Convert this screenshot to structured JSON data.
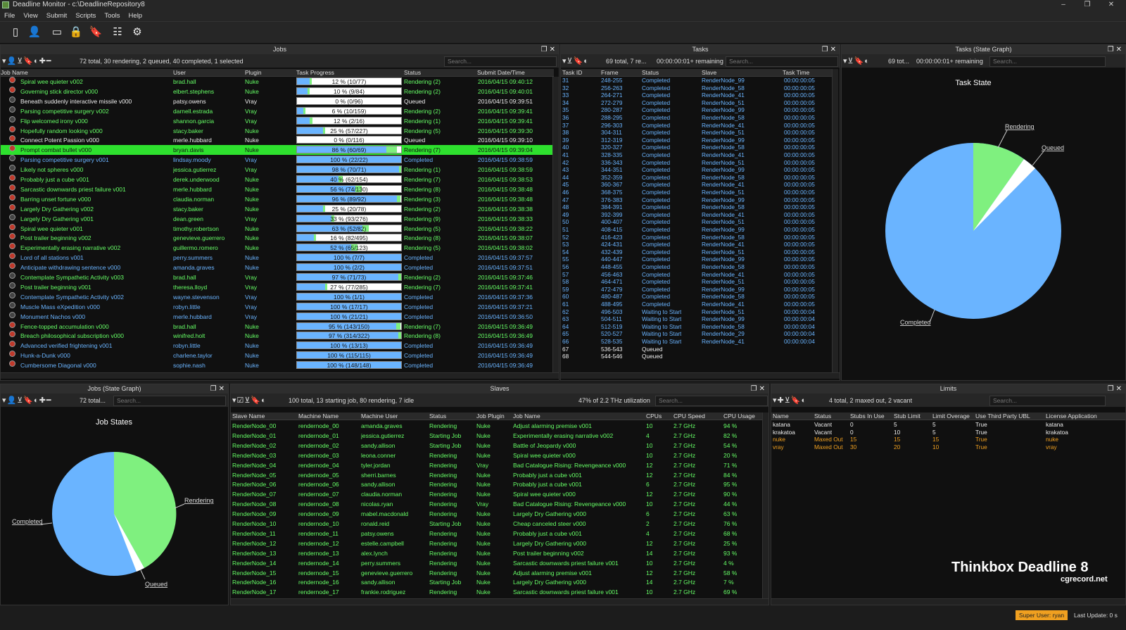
{
  "window": {
    "title": "Deadline Monitor  -  c:\\DeadlineRepository8",
    "controls": [
      "–",
      "❐",
      "✕"
    ]
  },
  "menu": [
    "File",
    "View",
    "Submit",
    "Scripts",
    "Tools",
    "Help"
  ],
  "toolbar_icons": [
    "server-icon",
    "user-icon",
    "monitor-icon",
    "lock-icon",
    "bookmark-icon",
    "settings-list-icon",
    "gear-icon"
  ],
  "jobs_panel": {
    "title": "Jobs",
    "summary": "72 total, 30 rendering, 2 queued, 40 completed, 1 selected",
    "search_placeholder": "Search...",
    "columns": [
      "Job Name",
      "User",
      "Plugin",
      "Task Progress",
      "Status",
      "Submit Date/Time"
    ],
    "rows": [
      [
        "Spiral wee quieter v002",
        "brad.hall",
        "Nuke",
        "12 %   (10/77)",
        "Rendering (2)",
        "2016/04/15 09:40:12",
        12,
        2
      ],
      [
        "Governing stick director v000",
        "elbert.stephens",
        "Nuke",
        "10 %   (9/84)",
        "Rendering (2)",
        "2016/04/15 09:40:01",
        10,
        2
      ],
      [
        "Beneath suddenly interactive missile v000",
        "patsy.owens",
        "Vray",
        "0 %   (0/96)",
        "Queued",
        "2016/04/15 09:39:51",
        0,
        0
      ],
      [
        "Parsing competitive surgery v002",
        "darnell.estrada",
        "Vray",
        "6 %   (10/159)",
        "Rendering (2)",
        "2016/04/15 09:39:41",
        6,
        2
      ],
      [
        "Flip welcomed irony v000",
        "shannon.garcia",
        "Vray",
        "12 %   (2/16)",
        "Rendering (1)",
        "2016/04/15 09:39:41",
        12,
        3
      ],
      [
        "Hopefully random looking v000",
        "stacy.baker",
        "Nuke",
        "25 %   (57/227)",
        "Rendering (5)",
        "2016/04/15 09:39:30",
        25,
        2
      ],
      [
        "Connect Potent Passion v000",
        "merle.hubbard",
        "Nuke",
        "0 %   (0/116)",
        "Queued",
        "2016/04/15 09:39:10",
        0,
        0
      ],
      [
        "Prompt combat bullet v000",
        "bryan.davis",
        "Nuke",
        "86 %   (60/69)",
        "Rendering (7)",
        "2016/04/15 09:39:04",
        86,
        10
      ],
      [
        "Parsing competitive surgery v001",
        "lindsay.moody",
        "Vray",
        "100 %   (22/22)",
        "Completed",
        "2016/04/15 09:38:59",
        100,
        0
      ],
      [
        "Likely not spheres v000",
        "jessica.gutierrez",
        "Vray",
        "98 %   (70/71)",
        "Rendering (1)",
        "2016/04/15 09:38:59",
        98,
        2
      ],
      [
        "Probably just a cube v001",
        "derek.underwood",
        "Nuke",
        "40 %   (62/154)",
        "Rendering (7)",
        "2016/04/15 09:38:53",
        40,
        4
      ],
      [
        "Sarcastic downwards priest failure v001",
        "merle.hubbard",
        "Nuke",
        "56 %   (74/130)",
        "Rendering (8)",
        "2016/04/15 09:38:48",
        56,
        6
      ],
      [
        "Barring unset fortune v000",
        "claudia.norman",
        "Nuke",
        "96 %   (89/92)",
        "Rendering (3)",
        "2016/04/15 09:38:48",
        96,
        3
      ],
      [
        "Largely Dry Gathering v002",
        "stacy.baker",
        "Nuke",
        "25 %   (20/78)",
        "Rendering (2)",
        "2016/04/15 09:38:38",
        25,
        2
      ],
      [
        "Largely Dry Gathering v001",
        "dean.green",
        "Vray",
        "33 %   (93/276)",
        "Rendering (9)",
        "2016/04/15 09:38:33",
        33,
        3
      ],
      [
        "Spiral wee quieter v001",
        "timothy.robertson",
        "Nuke",
        "63 %   (52/82)",
        "Rendering (5)",
        "2016/04/15 09:38:22",
        63,
        6
      ],
      [
        "Post trailer beginning v002",
        "genevieve.guerrero",
        "Nuke",
        "16 %   (82/495)",
        "Rendering (8)",
        "2016/04/15 09:38:07",
        16,
        2
      ],
      [
        "Experimentally erasing narrative v002",
        "guillermo.romero",
        "Nuke",
        "52 %   (65/123)",
        "Rendering (5)",
        "2016/04/15 09:38:02",
        52,
        6
      ],
      [
        "Lord of all stations v001",
        "perry.summers",
        "Nuke",
        "100 %   (7/7)",
        "Completed",
        "2016/04/15 09:37:57",
        100,
        0
      ],
      [
        "Anticipate withdrawing sentence v000",
        "amanda.graves",
        "Nuke",
        "100 %   (2/2)",
        "Completed",
        "2016/04/15 09:37:51",
        100,
        0
      ],
      [
        "Contemplate Sympathetic Activity v003",
        "brad.hall",
        "Vray",
        "97 %   (71/73)",
        "Rendering (2)",
        "2016/04/15 09:37:46",
        97,
        3
      ],
      [
        "Post trailer beginning v001",
        "theresa.lloyd",
        "Vray",
        "27 %   (77/285)",
        "Rendering (7)",
        "2016/04/15 09:37:41",
        27,
        2
      ],
      [
        "Contemplate Sympathetic Activity v002",
        "wayne.stevenson",
        "Vray",
        "100 %   (1/1)",
        "Completed",
        "2016/04/15 09:37:36",
        100,
        0
      ],
      [
        "Muscle Mass eXpedition v000",
        "robyn.little",
        "Vray",
        "100 %   (17/17)",
        "Completed",
        "2016/04/15 09:37:21",
        100,
        0
      ],
      [
        "Monument Nachos v000",
        "merle.hubbard",
        "Vray",
        "100 %   (21/21)",
        "Completed",
        "2016/04/15 09:36:50",
        100,
        0
      ],
      [
        "Fence-topped accumulation v000",
        "brad.hall",
        "Nuke",
        "95 %   (143/150)",
        "Rendering (7)",
        "2016/04/15 09:36:49",
        95,
        4
      ],
      [
        "Breach philosophical subscription v000",
        "winifred.holt",
        "Nuke",
        "97 %   (314/322)",
        "Rendering (8)",
        "2016/04/15 09:36:49",
        97,
        3
      ],
      [
        "Advanced verified frightening v001",
        "robyn.little",
        "Nuke",
        "100 %   (13/13)",
        "Completed",
        "2016/04/15 09:36:49",
        100,
        0
      ],
      [
        "Hunk-a-Dunk v000",
        "charlene.taylor",
        "Nuke",
        "100 %   (115/115)",
        "Completed",
        "2016/04/15 09:36:49",
        100,
        0
      ],
      [
        "Cumbersome Diagonal v000",
        "sophie.nash",
        "Nuke",
        "100 %   (148/148)",
        "Completed",
        "2016/04/15 09:36:49",
        100,
        0
      ]
    ]
  },
  "tasks_panel": {
    "title": "Tasks",
    "summary": "69 total, 7 re...",
    "remaining": "00:00:00:01+ remaining",
    "search_placeholder": "Search...",
    "columns": [
      "Task ID",
      "Frame",
      "Status",
      "Slave",
      "Task Time"
    ],
    "rows": [
      [
        "31",
        "248-255",
        "Completed",
        "RenderNode_99",
        "00:00:00:05"
      ],
      [
        "32",
        "256-263",
        "Completed",
        "RenderNode_58",
        "00:00:00:05"
      ],
      [
        "33",
        "264-271",
        "Completed",
        "RenderNode_41",
        "00:00:00:05"
      ],
      [
        "34",
        "272-279",
        "Completed",
        "RenderNode_51",
        "00:00:00:05"
      ],
      [
        "35",
        "280-287",
        "Completed",
        "RenderNode_99",
        "00:00:00:05"
      ],
      [
        "36",
        "288-295",
        "Completed",
        "RenderNode_58",
        "00:00:00:05"
      ],
      [
        "37",
        "296-303",
        "Completed",
        "RenderNode_41",
        "00:00:00:05"
      ],
      [
        "38",
        "304-311",
        "Completed",
        "RenderNode_51",
        "00:00:00:05"
      ],
      [
        "39",
        "312-319",
        "Completed",
        "RenderNode_99",
        "00:00:00:05"
      ],
      [
        "40",
        "320-327",
        "Completed",
        "RenderNode_58",
        "00:00:00:05"
      ],
      [
        "41",
        "328-335",
        "Completed",
        "RenderNode_41",
        "00:00:00:05"
      ],
      [
        "42",
        "336-343",
        "Completed",
        "RenderNode_51",
        "00:00:00:05"
      ],
      [
        "43",
        "344-351",
        "Completed",
        "RenderNode_99",
        "00:00:00:05"
      ],
      [
        "44",
        "352-359",
        "Completed",
        "RenderNode_58",
        "00:00:00:05"
      ],
      [
        "45",
        "360-367",
        "Completed",
        "RenderNode_41",
        "00:00:00:05"
      ],
      [
        "46",
        "368-375",
        "Completed",
        "RenderNode_51",
        "00:00:00:05"
      ],
      [
        "47",
        "376-383",
        "Completed",
        "RenderNode_99",
        "00:00:00:05"
      ],
      [
        "48",
        "384-391",
        "Completed",
        "RenderNode_58",
        "00:00:00:05"
      ],
      [
        "49",
        "392-399",
        "Completed",
        "RenderNode_41",
        "00:00:00:05"
      ],
      [
        "50",
        "400-407",
        "Completed",
        "RenderNode_51",
        "00:00:00:05"
      ],
      [
        "51",
        "408-415",
        "Completed",
        "RenderNode_99",
        "00:00:00:05"
      ],
      [
        "52",
        "416-423",
        "Completed",
        "RenderNode_58",
        "00:00:00:05"
      ],
      [
        "53",
        "424-431",
        "Completed",
        "RenderNode_41",
        "00:00:00:05"
      ],
      [
        "54",
        "432-439",
        "Completed",
        "RenderNode_51",
        "00:00:00:05"
      ],
      [
        "55",
        "440-447",
        "Completed",
        "RenderNode_99",
        "00:00:00:05"
      ],
      [
        "56",
        "448-455",
        "Completed",
        "RenderNode_58",
        "00:00:00:05"
      ],
      [
        "57",
        "456-463",
        "Completed",
        "RenderNode_41",
        "00:00:00:05"
      ],
      [
        "58",
        "464-471",
        "Completed",
        "RenderNode_51",
        "00:00:00:05"
      ],
      [
        "59",
        "472-479",
        "Completed",
        "RenderNode_99",
        "00:00:00:05"
      ],
      [
        "60",
        "480-487",
        "Completed",
        "RenderNode_58",
        "00:00:00:05"
      ],
      [
        "61",
        "488-495",
        "Completed",
        "RenderNode_41",
        "00:00:00:05"
      ],
      [
        "62",
        "496-503",
        "Waiting to Start",
        "RenderNode_51",
        "00:00:00:04"
      ],
      [
        "63",
        "504-511",
        "Waiting to Start",
        "RenderNode_99",
        "00:00:00:04"
      ],
      [
        "64",
        "512-519",
        "Waiting to Start",
        "RenderNode_58",
        "00:00:00:04"
      ],
      [
        "65",
        "520-527",
        "Waiting to Start",
        "RenderNode_29",
        "00:00:00:04"
      ],
      [
        "66",
        "528-535",
        "Waiting to Start",
        "RenderNode_41",
        "00:00:00:04"
      ],
      [
        "67",
        "536-543",
        "Queued",
        "",
        ""
      ],
      [
        "68",
        "544-546",
        "Queued",
        "",
        ""
      ]
    ]
  },
  "task_state_graph": {
    "title": "Tasks (State Graph)",
    "summary": "69 tot...",
    "remaining": "00:00:00:01+ remaining",
    "search_placeholder": "Search...",
    "heading": "Task State",
    "labels": {
      "rendering": "Rendering",
      "queued": "Queued",
      "completed": "Completed"
    }
  },
  "job_state_graph": {
    "title": "Jobs (State Graph)",
    "summary": "72 total...",
    "search_placeholder": "Search...",
    "heading": "Job States",
    "labels": {
      "rendering": "Rendering",
      "queued": "Queued",
      "completed": "Completed"
    }
  },
  "slaves_panel": {
    "title": "Slaves",
    "summary": "100 total, 13 starting job, 80 rendering, 7 idle",
    "utilization": "47% of 2.2 THz utilization",
    "search_placeholder": "Search...",
    "columns": [
      "Slave Name",
      "Machine Name",
      "Machine User",
      "Status",
      "Job Plugin",
      "Job Name",
      "CPUs",
      "CPU Speed",
      "CPU Usage"
    ],
    "rows": [
      [
        "RenderNode_00",
        "rendernode_00",
        "amanda.graves",
        "Rendering",
        "Nuke",
        "Adjust alarming premise v001",
        "10",
        "2.7 GHz",
        "94 %"
      ],
      [
        "RenderNode_01",
        "rendernode_01",
        "jessica.gutierrez",
        "Starting Job",
        "Nuke",
        "Experimentally erasing narrative v002",
        "4",
        "2.7 GHz",
        "82 %"
      ],
      [
        "RenderNode_02",
        "rendernode_02",
        "sandy.allison",
        "Starting Job",
        "Nuke",
        "Battle of Jeopardy v000",
        "10",
        "2.7 GHz",
        "54 %"
      ],
      [
        "RenderNode_03",
        "rendernode_03",
        "leona.conner",
        "Rendering",
        "Nuke",
        "Spiral wee quieter v000",
        "10",
        "2.7 GHz",
        "20 %"
      ],
      [
        "RenderNode_04",
        "rendernode_04",
        "tyler.jordan",
        "Rendering",
        "Vray",
        "Bad Catalogue Rising: Revengeance v000",
        "12",
        "2.7 GHz",
        "71 %"
      ],
      [
        "RenderNode_05",
        "rendernode_05",
        "sherri.barnes",
        "Rendering",
        "Nuke",
        "Probably just a cube v001",
        "12",
        "2.7 GHz",
        "84 %"
      ],
      [
        "RenderNode_06",
        "rendernode_06",
        "sandy.allison",
        "Rendering",
        "Nuke",
        "Probably just a cube v001",
        "6",
        "2.7 GHz",
        "95 %"
      ],
      [
        "RenderNode_07",
        "rendernode_07",
        "claudia.norman",
        "Rendering",
        "Nuke",
        "Spiral wee quieter v000",
        "12",
        "2.7 GHz",
        "90 %"
      ],
      [
        "RenderNode_08",
        "rendernode_08",
        "nicolas.ryan",
        "Rendering",
        "Vray",
        "Bad Catalogue Rising: Revengeance v000",
        "10",
        "2.7 GHz",
        "44 %"
      ],
      [
        "RenderNode_09",
        "rendernode_09",
        "mabel.macdonald",
        "Rendering",
        "Nuke",
        "Largely Dry Gathering v000",
        "6",
        "2.7 GHz",
        "63 %"
      ],
      [
        "RenderNode_10",
        "rendernode_10",
        "ronald.reid",
        "Starting Job",
        "Nuke",
        "Cheap canceled steer v000",
        "2",
        "2.7 GHz",
        "76 %"
      ],
      [
        "RenderNode_11",
        "rendernode_11",
        "patsy.owens",
        "Rendering",
        "Nuke",
        "Probably just a cube v001",
        "4",
        "2.7 GHz",
        "68 %"
      ],
      [
        "RenderNode_12",
        "rendernode_12",
        "estelle.campbell",
        "Rendering",
        "Nuke",
        "Largely Dry Gathering v000",
        "12",
        "2.7 GHz",
        "25 %"
      ],
      [
        "RenderNode_13",
        "rendernode_13",
        "alex.lynch",
        "Rendering",
        "Nuke",
        "Post trailer beginning v002",
        "14",
        "2.7 GHz",
        "93 %"
      ],
      [
        "RenderNode_14",
        "rendernode_14",
        "perry.summers",
        "Rendering",
        "Nuke",
        "Sarcastic downwards priest failure v001",
        "10",
        "2.7 GHz",
        "4 %"
      ],
      [
        "RenderNode_15",
        "rendernode_15",
        "genevieve.guerrero",
        "Rendering",
        "Nuke",
        "Adjust alarming premise v001",
        "12",
        "2.7 GHz",
        "58 %"
      ],
      [
        "RenderNode_16",
        "rendernode_16",
        "sandy.allison",
        "Starting Job",
        "Nuke",
        "Largely Dry Gathering v000",
        "14",
        "2.7 GHz",
        "7 %"
      ],
      [
        "RenderNode_17",
        "rendernode_17",
        "frankie.rodriguez",
        "Rendering",
        "Nuke",
        "Sarcastic downwards priest failure v001",
        "10",
        "2.7 GHz",
        "69 %"
      ]
    ]
  },
  "limits_panel": {
    "title": "Limits",
    "summary": "4 total, 2 maxed out, 2 vacant",
    "search_placeholder": "Search...",
    "columns": [
      "Name",
      "Status",
      "Stubs In Use",
      "Stub Limit",
      "Limit Overage",
      "Use Third Party UBL",
      "License Application"
    ],
    "rows": [
      [
        "katana",
        "Vacant",
        "0",
        "5",
        "5",
        "True",
        "katana"
      ],
      [
        "krakatoa",
        "Vacant",
        "0",
        "10",
        "5",
        "True",
        "krakatoa"
      ],
      [
        "nuke",
        "Maxed Out",
        "15",
        "15",
        "15",
        "True",
        "nuke"
      ],
      [
        "vray",
        "Maxed Out",
        "30",
        "20",
        "10",
        "True",
        "vray"
      ]
    ]
  },
  "branding": {
    "title": "Thinkbox Deadline 8",
    "site": "cgrecord.net"
  },
  "status_bar": {
    "super_user": "Super User: ryan",
    "last_update": "Last Update: 0 s"
  },
  "colors": {
    "accent_green": "#6ff06f",
    "accent_blue": "#6ab4ff",
    "selected_row": "#2ee02e",
    "maxed_out": "#f0a020"
  }
}
